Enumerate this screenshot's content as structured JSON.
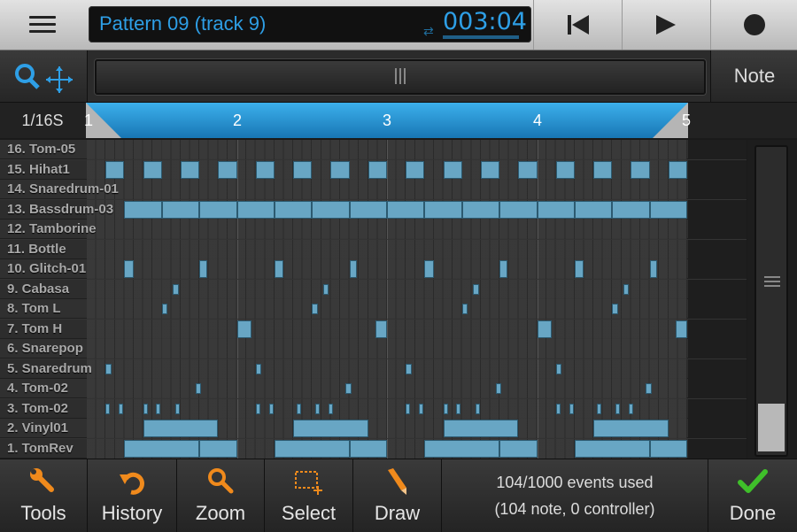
{
  "header": {
    "pattern_title": "Pattern 09 (track 9)",
    "time": "003:04",
    "menu_icon": "menu-icon",
    "transport": [
      "rewind-icon",
      "play-icon",
      "record-icon"
    ]
  },
  "toolbar2": {
    "zoom_move_icon": "zoom-move-icon",
    "note_label": "Note"
  },
  "ruler": {
    "quantize": "1/16S",
    "bars": [
      "1",
      "2",
      "3",
      "4",
      "5"
    ]
  },
  "colors": {
    "accent": "#2e9fe6",
    "note": "#68a6c4",
    "loop": "#1d86c4"
  },
  "tracks": [
    {
      "label": "16. Tom-05",
      "notes": []
    },
    {
      "label": "15. Hihat1",
      "notes": [
        [
          0.5,
          1
        ],
        [
          1.5,
          2
        ],
        [
          2.5,
          3
        ],
        [
          3.5,
          4
        ],
        [
          4.5,
          5
        ],
        [
          5.5,
          6
        ],
        [
          6.5,
          7
        ],
        [
          7.5,
          8
        ],
        [
          8.5,
          9
        ],
        [
          9.5,
          10
        ],
        [
          10.5,
          11
        ],
        [
          11.5,
          12
        ],
        [
          12.5,
          13
        ],
        [
          13.5,
          14
        ],
        [
          14.5,
          15
        ],
        [
          15.5,
          16
        ]
      ],
      "small": false
    },
    {
      "label": "14. Snaredrum-01",
      "notes": []
    },
    {
      "label": "13. Bassdrum-03",
      "notes": [
        [
          1,
          2
        ],
        [
          2,
          3
        ],
        [
          3,
          4
        ],
        [
          4,
          5
        ],
        [
          5,
          6
        ],
        [
          6,
          7
        ],
        [
          7,
          8
        ],
        [
          8,
          9
        ],
        [
          9,
          10
        ],
        [
          10,
          11
        ],
        [
          11,
          12
        ],
        [
          12,
          13
        ],
        [
          13,
          14
        ],
        [
          14,
          15
        ],
        [
          15,
          16
        ]
      ],
      "small": false
    },
    {
      "label": "12. Tamborine",
      "notes": []
    },
    {
      "label": "11. Bottle",
      "notes": []
    },
    {
      "label": "10. Glitch-01",
      "notes": [
        [
          1,
          1.25
        ],
        [
          3,
          3.2
        ],
        [
          5,
          5.25
        ],
        [
          7,
          7.2
        ],
        [
          9,
          9.25
        ],
        [
          11,
          11.2
        ],
        [
          13,
          13.25
        ],
        [
          15,
          15.2
        ]
      ],
      "small": false
    },
    {
      "label": "9. Cabasa",
      "notes": [
        [
          2.3,
          2.45
        ],
        [
          6.3,
          6.45
        ],
        [
          10.3,
          10.45
        ],
        [
          14.3,
          14.45
        ]
      ],
      "small": true
    },
    {
      "label": "8. Tom L",
      "notes": [
        [
          2,
          2.15
        ],
        [
          6,
          6.15
        ],
        [
          10,
          10.15
        ],
        [
          14,
          14.15
        ]
      ],
      "small": true
    },
    {
      "label": "7. Tom H",
      "notes": [
        [
          4,
          4.4
        ],
        [
          7.7,
          8.0
        ],
        [
          12,
          12.4
        ],
        [
          15.7,
          16
        ]
      ],
      "small": false
    },
    {
      "label": "6. Snarepop",
      "notes": []
    },
    {
      "label": "5. Snaredrum",
      "notes": [
        [
          0.5,
          0.65
        ],
        [
          4.5,
          4.65
        ],
        [
          8.5,
          8.65
        ],
        [
          12.5,
          12.65
        ]
      ],
      "small": true
    },
    {
      "label": "4. Tom-02",
      "notes": [
        [
          2.9,
          3.05
        ],
        [
          6.9,
          7.05
        ],
        [
          10.9,
          11.05
        ],
        [
          14.9,
          15.05
        ]
      ],
      "small": true
    },
    {
      "label": "3. Tom-02",
      "notes": [
        [
          0.5,
          0.6
        ],
        [
          0.85,
          0.95
        ],
        [
          1.5,
          1.6
        ],
        [
          1.85,
          1.95
        ],
        [
          2.35,
          2.45
        ],
        [
          4.5,
          4.6
        ],
        [
          4.85,
          4.95
        ],
        [
          5.6,
          5.7
        ],
        [
          6.1,
          6.2
        ],
        [
          6.45,
          6.55
        ],
        [
          8.5,
          8.6
        ],
        [
          8.85,
          8.95
        ],
        [
          9.5,
          9.6
        ],
        [
          9.85,
          9.95
        ],
        [
          10.35,
          10.45
        ],
        [
          12.5,
          12.6
        ],
        [
          12.85,
          12.95
        ],
        [
          13.6,
          13.7
        ],
        [
          14.1,
          14.2
        ],
        [
          14.45,
          14.55
        ]
      ],
      "small": true
    },
    {
      "label": "2. Vinyl01",
      "notes": [
        [
          1.5,
          3.5
        ],
        [
          5.5,
          7.5
        ],
        [
          9.5,
          11.5
        ],
        [
          13.5,
          15.5
        ]
      ],
      "small": false
    },
    {
      "label": "1. TomRev",
      "notes": [
        [
          1,
          3
        ],
        [
          3,
          4
        ],
        [
          5,
          7
        ],
        [
          7,
          8
        ],
        [
          9,
          11
        ],
        [
          11,
          12
        ],
        [
          13,
          15
        ],
        [
          15,
          16
        ]
      ],
      "small": false
    }
  ],
  "status": {
    "line1": "104/1000 events used",
    "line2": "(104 note, 0 controller)"
  },
  "bottom_buttons": [
    {
      "name": "tools-button",
      "icon": "wrench-icon",
      "label": "Tools"
    },
    {
      "name": "history-button",
      "icon": "undo-icon",
      "label": "History"
    },
    {
      "name": "zoom-button",
      "icon": "magnifier-icon",
      "label": "Zoom"
    },
    {
      "name": "select-button",
      "icon": "select-rect-icon",
      "label": "Select"
    },
    {
      "name": "draw-button",
      "icon": "pencil-icon",
      "label": "Draw"
    }
  ],
  "done_label": "Done"
}
